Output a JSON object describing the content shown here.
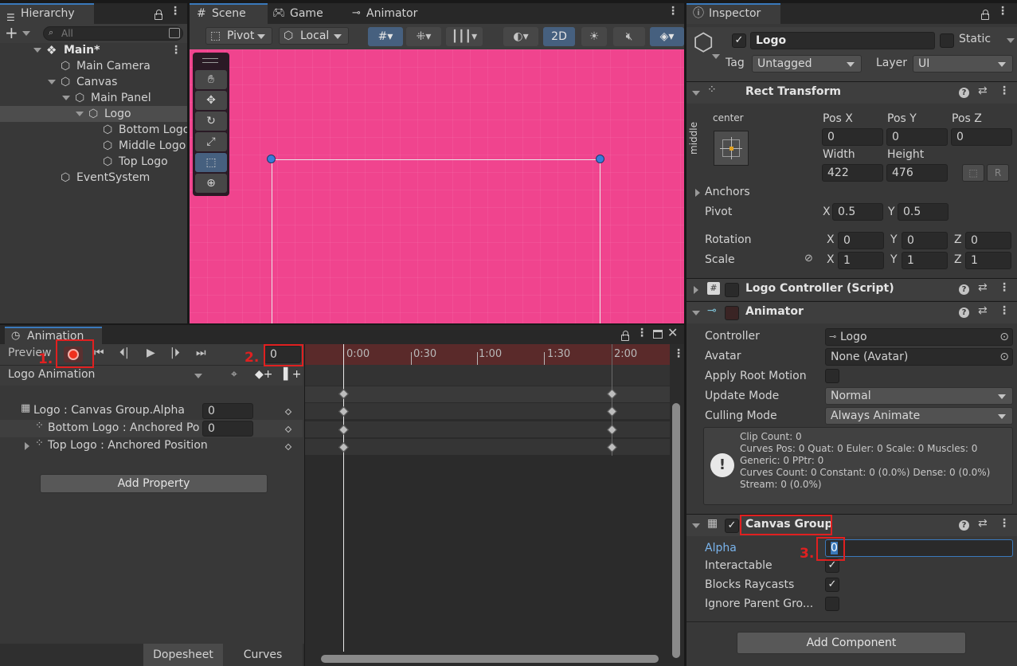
{
  "hierarchy": {
    "tab": "Hierarchy",
    "search_placeholder": "All",
    "items": [
      {
        "label": "Main*"
      },
      {
        "label": "Main Camera"
      },
      {
        "label": "Canvas"
      },
      {
        "label": "Main Panel"
      },
      {
        "label": "Logo"
      },
      {
        "label": "Bottom Logo"
      },
      {
        "label": "Middle Logo"
      },
      {
        "label": "Top Logo"
      },
      {
        "label": "EventSystem"
      }
    ]
  },
  "scene": {
    "tabs": [
      "Scene",
      "Game",
      "Animator"
    ],
    "toolbar": {
      "pivot": "Pivot",
      "local": "Local",
      "mode_2d": "2D"
    },
    "background_color": "#f0448e"
  },
  "animation": {
    "tab": "Animation",
    "preview_label": "Preview",
    "frame_value": "0",
    "clip": "Logo Animation",
    "ruler": [
      "0:00",
      "0:30",
      "1:00",
      "1:30",
      "2:00"
    ],
    "properties": [
      {
        "label": "Logo : Canvas Group.Alpha",
        "value": "0"
      },
      {
        "label": "Bottom Logo : Anchored Po",
        "value": "0"
      },
      {
        "label": "Top Logo : Anchored Position",
        "value": ""
      }
    ],
    "add_property": "Add Property",
    "bottom_tabs": [
      "Dopesheet",
      "Curves"
    ]
  },
  "annotations": {
    "step1": "1.",
    "step2": "2.",
    "step3": "3."
  },
  "inspector": {
    "tab": "Inspector",
    "object_name": "Logo",
    "static_label": "Static",
    "tag_label": "Tag",
    "tag_value": "Untagged",
    "layer_label": "Layer",
    "layer_value": "UI",
    "rect_transform": {
      "title": "Rect Transform",
      "anchor_h": "center",
      "anchor_v": "middle",
      "pos_x_label": "Pos X",
      "pos_x": "0",
      "pos_y_label": "Pos Y",
      "pos_y": "0",
      "pos_z_label": "Pos Z",
      "pos_z": "0",
      "width_label": "Width",
      "width": "422",
      "height_label": "Height",
      "height": "476",
      "anchors_label": "Anchors",
      "pivot_label": "Pivot",
      "pivot_x": "0.5",
      "pivot_y": "0.5",
      "rotation_label": "Rotation",
      "rot_x": "0",
      "rot_y": "0",
      "rot_z": "0",
      "scale_label": "Scale",
      "scale_x": "1",
      "scale_y": "1",
      "scale_z": "1",
      "x": "X",
      "y": "Y",
      "z": "Z",
      "r": "R"
    },
    "logo_controller": {
      "title": "Logo Controller (Script)"
    },
    "animator": {
      "title": "Animator",
      "controller_label": "Controller",
      "controller_value": "Logo",
      "avatar_label": "Avatar",
      "avatar_value": "None (Avatar)",
      "apply_root_motion_label": "Apply Root Motion",
      "update_mode_label": "Update Mode",
      "update_mode_value": "Normal",
      "culling_mode_label": "Culling Mode",
      "culling_mode_value": "Always Animate",
      "info": [
        "Clip Count: 0",
        "Curves Pos: 0 Quat: 0 Euler: 0 Scale: 0 Muscles: 0",
        "Generic: 0 PPtr: 0",
        "Curves Count: 0 Constant: 0 (0.0%) Dense: 0 (0.0%)",
        "Stream: 0 (0.0%)"
      ]
    },
    "canvas_group": {
      "title": "Canvas Group",
      "alpha_label": "Alpha",
      "alpha_value": "0",
      "interactable_label": "Interactable",
      "blocks_raycasts_label": "Blocks Raycasts",
      "ignore_parent_label": "Ignore Parent Gro..."
    },
    "add_component": "Add Component"
  }
}
